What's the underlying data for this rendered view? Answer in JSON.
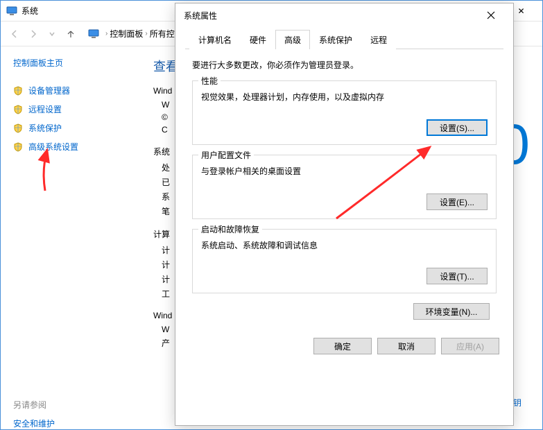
{
  "parent_window": {
    "title": "系统",
    "breadcrumb": {
      "items": [
        "控制面板",
        "所有控..."
      ],
      "sep": "›"
    },
    "window_controls": {
      "min": "—",
      "max": "☐",
      "close": "✕"
    }
  },
  "sidebar": {
    "home": "控制面板主页",
    "items": [
      {
        "label": "设备管理器"
      },
      {
        "label": "远程设置"
      },
      {
        "label": "系统保护"
      },
      {
        "label": "高级系统设置"
      }
    ],
    "see_also_label": "另请参阅",
    "see_also_link": "安全和维护"
  },
  "right": {
    "heading": "查看",
    "windows_label": "Wind",
    "windows_line1": "W",
    "windows_line2": "©",
    "windows_line3": "C",
    "ten_glyph": "0",
    "section2_title": "系统",
    "section2_lines": [
      "处",
      "已",
      "系",
      "笔"
    ],
    "section3_title": "计算",
    "section3_lines": [
      "计",
      "计",
      "计",
      "工"
    ],
    "section4_title": "Wind",
    "section4_lines": [
      "W",
      "产"
    ],
    "bottom_link": "密钥"
  },
  "dialog": {
    "title": "系统属性",
    "close_glyph": "✕",
    "tabs": [
      {
        "label": "计算机名",
        "active": false
      },
      {
        "label": "硬件",
        "active": false
      },
      {
        "label": "高级",
        "active": true
      },
      {
        "label": "系统保护",
        "active": false
      },
      {
        "label": "远程",
        "active": false
      }
    ],
    "note": "要进行大多数更改，你必须作为管理员登录。",
    "groups": [
      {
        "title": "性能",
        "desc": "视觉效果，处理器计划，内存使用，以及虚拟内存",
        "button": "设置(S)...",
        "highlight": true
      },
      {
        "title": "用户配置文件",
        "desc": "与登录帐户相关的桌面设置",
        "button": "设置(E)...",
        "highlight": false
      },
      {
        "title": "启动和故障恢复",
        "desc": "系统启动、系统故障和调试信息",
        "button": "设置(T)...",
        "highlight": false
      }
    ],
    "env_button": "环境变量(N)...",
    "buttons": {
      "ok": "确定",
      "cancel": "取消",
      "apply": "应用(A)"
    }
  }
}
